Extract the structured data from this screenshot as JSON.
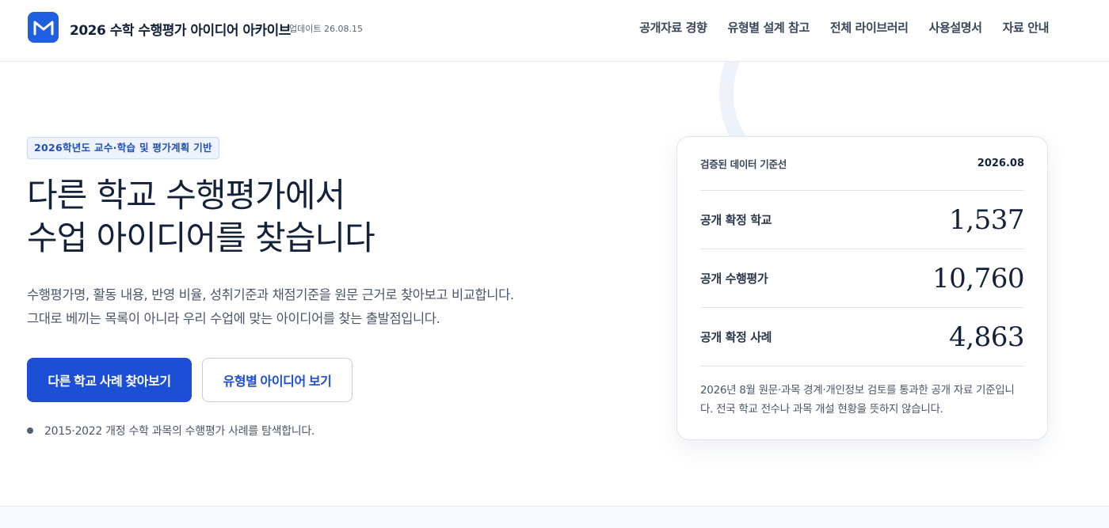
{
  "header": {
    "logo_icon": "m-logo-icon",
    "title": "2026 수학 수행평가 아이디어 아카이브",
    "update": "업데이트 26.08.15",
    "nav": [
      "공개자료 경향",
      "유형별 설계 참고",
      "전체 라이브러리",
      "사용설명서",
      "자료 안내"
    ]
  },
  "hero": {
    "badge": "2026학년도 교수·학습 및 평가계획 기반",
    "title_line1": "다른 학교 수행평가에서",
    "title_line2": "수업 아이디어를 찾습니다",
    "desc_line1": "수행평가명, 활동 내용, 반영 비율, 성취기준과 채점기준을 원문 근거로 찾아보고 비교합니다.",
    "desc_line2": "그대로 베끼는 목록이 아니라 우리 수업에 맞는 아이디어를 찾는 출발점입니다.",
    "primary_button": "다른 학교 사례 찾아보기",
    "secondary_button": "유형별 아이디어 보기",
    "note": "2015·2022 개정 수학 과목의 수행평가 사례를 탐색합니다."
  },
  "card": {
    "head_label": "검증된 데이터 기준선",
    "head_value": "2026.08",
    "stats": [
      {
        "label": "공개 확정 학교",
        "value": "1,537"
      },
      {
        "label": "공개 수행평가",
        "value": "10,760"
      },
      {
        "label": "공개 확정 사례",
        "value": "4,863"
      }
    ],
    "footnote_line1": "2026년 8월 원문·과목 경계·개인정보 검토를 통과한 공개 자료 기준입니",
    "footnote_line2": "다. 전국 학교 전수나 과목 개설 현황을 뜻하지 않습니다."
  },
  "colors": {
    "accent": "#1d4fd6",
    "text_dark": "#14213a",
    "badge_bg": "#eef3fd"
  }
}
